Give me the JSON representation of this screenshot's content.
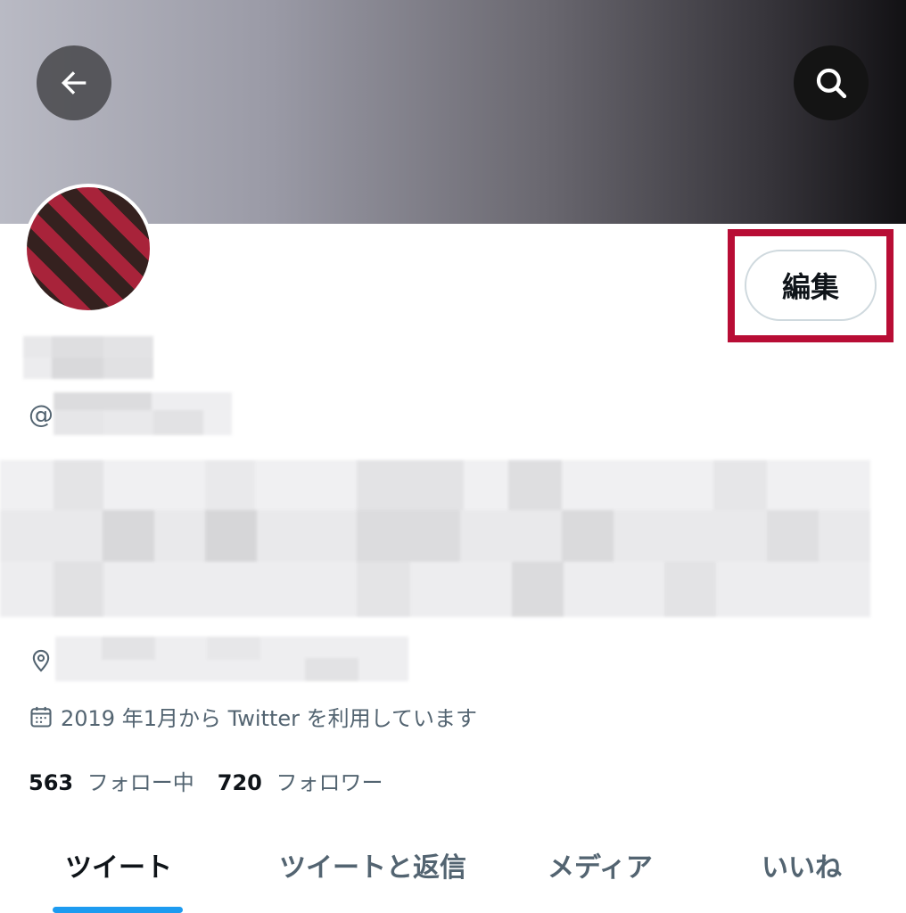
{
  "header": {
    "back_icon": "arrow-left-icon",
    "search_icon": "search-icon"
  },
  "profile": {
    "edit_label": "編集",
    "handle_prefix": "@",
    "joined_text": "2019 年1月から Twitter を利用しています",
    "following_count": "563",
    "following_label": "フォロー中",
    "followers_count": "720",
    "followers_label": "フォロワー"
  },
  "tabs": [
    {
      "label": "ツイート"
    },
    {
      "label": "ツイートと返信"
    },
    {
      "label": "メディア"
    },
    {
      "label": "いいね"
    }
  ],
  "colors": {
    "accent": "#1d9bf0",
    "highlight": "#b80d35",
    "avatar_red": "#a8233a",
    "avatar_dark": "#35211f"
  }
}
